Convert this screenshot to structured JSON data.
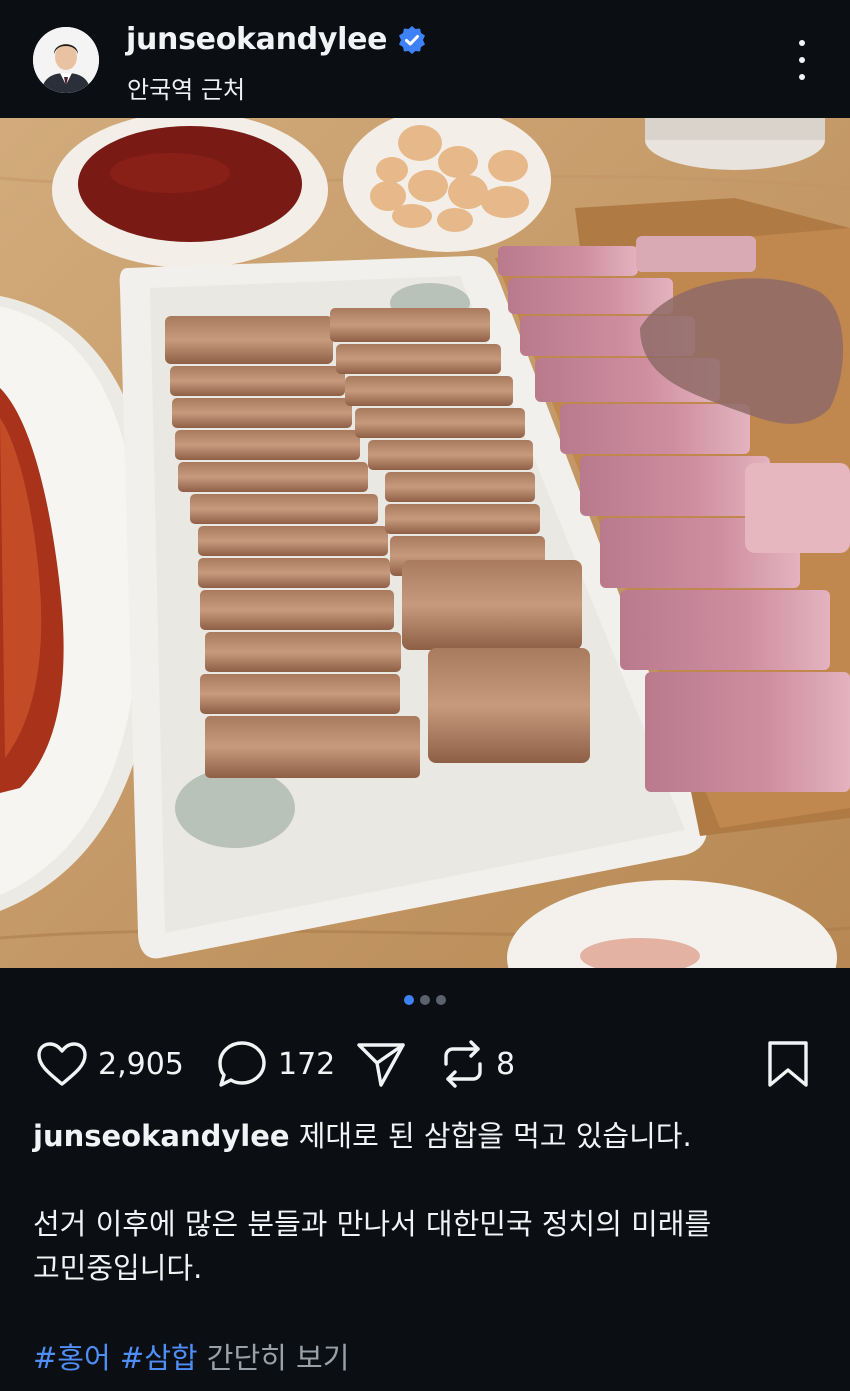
{
  "header": {
    "username": "junseokandylee",
    "location": "안국역 근처",
    "verified": true
  },
  "post": {
    "carousel": {
      "current": 1,
      "total": 3
    },
    "counts": {
      "likes": "2,905",
      "comments": "172",
      "reposts": "8"
    },
    "caption_user": "junseokandylee",
    "caption_text": "제대로 된 삼합을 먹고 있습니다.",
    "body_line1": "선거 이후에 많은 분들과 만나서 대한민국 정치의 미래를",
    "body_line2": "고민중입니다.",
    "hashtags": [
      "#홍어",
      "#삼합"
    ],
    "more_label": "간단히 보기"
  },
  "colors": {
    "background": "#0b0f14",
    "text": "#f2f3f5",
    "hashtag": "#4f8ef7",
    "verified_badge": "#3c82f6",
    "muted": "#9aa0a8"
  },
  "icons": {
    "like": "heart-icon",
    "comment": "speech-bubble-icon",
    "share": "paper-plane-icon",
    "repost": "repost-arrows-icon",
    "save": "bookmark-icon",
    "menu": "vertical-dots-icon",
    "verified": "verified-badge-icon"
  }
}
